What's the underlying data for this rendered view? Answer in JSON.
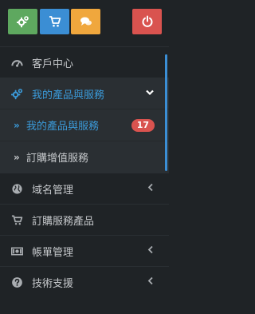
{
  "top_buttons": [
    {
      "icon": "cogs-icon",
      "color": "#5ea85f"
    },
    {
      "icon": "shopping-cart-icon",
      "color": "#3b8ed4"
    },
    {
      "icon": "comments-icon",
      "color": "#f0a73d"
    },
    {
      "icon": "power-icon",
      "color": "#d9534f"
    }
  ],
  "nav": {
    "client_center": {
      "label": "客戶中心",
      "icon": "dashboard-icon"
    },
    "my_products": {
      "label": "我的產品與服務",
      "icon": "cogs-icon",
      "chevron": "❯",
      "submenu": [
        {
          "label": "我的產品與服務",
          "badge": "17"
        },
        {
          "label": "訂購增值服務"
        }
      ]
    },
    "domain_management": {
      "label": "域名管理",
      "icon": "globe-icon",
      "chevron": "‹"
    },
    "order_services": {
      "label": "訂購服務產品",
      "icon": "shopping-cart-icon"
    },
    "billing": {
      "label": "帳單管理",
      "icon": "money-icon",
      "chevron": "‹"
    },
    "support": {
      "label": "技術支援",
      "icon": "question-circle-icon",
      "chevron": "‹"
    }
  },
  "colors": {
    "accent": "#3b9ad9",
    "background": "#1f2326",
    "active_background": "#2a2f33",
    "badge": "#d9534f"
  }
}
